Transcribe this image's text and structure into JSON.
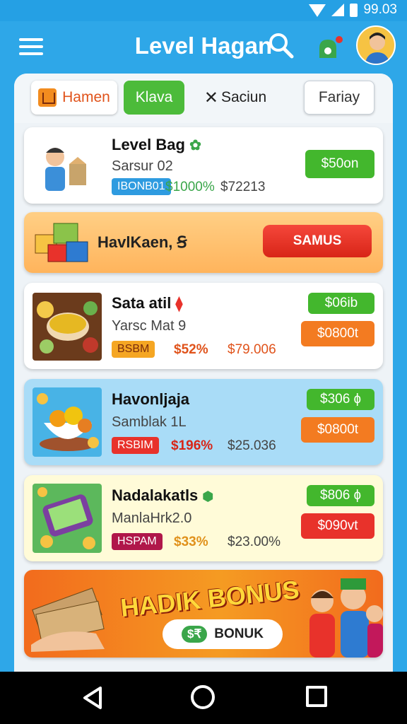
{
  "status": {
    "time": "99.03"
  },
  "appbar": {
    "title": "Level Hagan"
  },
  "tabs": [
    {
      "label": "Hamen"
    },
    {
      "label": "Klava"
    },
    {
      "label": "Saciun",
      "prefix": "✕"
    },
    {
      "label": "Fariay"
    }
  ],
  "items": [
    {
      "name": "Level Bag",
      "sub": "Sarsur 02",
      "badge": "IBONB01",
      "pct": "$1000%",
      "price": "$72213",
      "button": "$50on"
    },
    {
      "name": "Sata atil",
      "sub": "Yarsc Mat 9",
      "badge": "BSBM",
      "pct": "$52%",
      "price": "$79.006",
      "button_top": "$06ib",
      "button_bottom": "$0800t"
    },
    {
      "name": "Havonljaja",
      "sub": "Samblak 1L",
      "badge": "RSBIM",
      "pct": "$196%",
      "price": "$25.036",
      "button_top": "$306 ɸ",
      "button_bottom": "$0800t"
    },
    {
      "name": "Nadalakatls",
      "sub": "ManlaHrk2.0",
      "badge": "HSPAM",
      "pct": "$33%",
      "price": "$23.00%",
      "button_top": "$806 ɸ",
      "button_bottom": "$090vt"
    }
  ],
  "promo": {
    "text": "HavlKaen, Ꞩ",
    "button": "SAMUS"
  },
  "banner": {
    "title": "HADIK BONUS",
    "button_icon": "$₹",
    "button_label": "BONUK"
  },
  "icons": [
    "menu-icon",
    "search-icon",
    "gift-icon",
    "avatar",
    "back-icon",
    "home-icon",
    "recent-apps-icon"
  ],
  "colors": {
    "primary": "#2ea7e8",
    "green": "#43b72d",
    "red": "#e8322b",
    "orange": "#f37b21"
  }
}
